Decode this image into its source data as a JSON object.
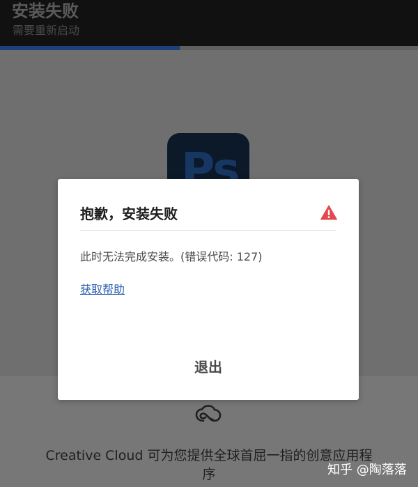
{
  "header": {
    "title": "安装失败",
    "subtitle": "需要重新启动",
    "progress": 0.43,
    "progress_color": "#1e3f7a"
  },
  "app_icon": {
    "letters": "Ps",
    "tile_color": "#0b1928",
    "letter_color": "#173763"
  },
  "dialog": {
    "title": "抱歉，安装失败",
    "icon": "alert-triangle-icon",
    "icon_color": "#e34850",
    "message": "此时无法完成安装。(错误代码: 127)",
    "help_link": "获取帮助",
    "exit_label": "退出"
  },
  "footer": {
    "logo_icon": "creative-cloud-icon",
    "promo_text": "Creative Cloud 可为您提供全球首屈一指的创意应用程序"
  },
  "watermark": "知乎 @陶落落"
}
